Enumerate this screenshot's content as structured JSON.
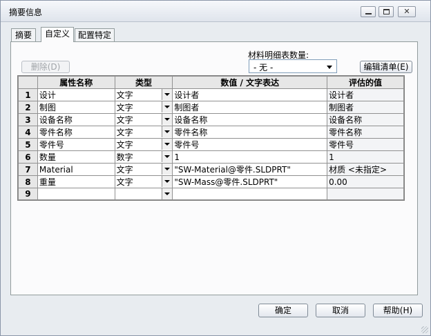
{
  "window": {
    "title": "摘要信息"
  },
  "tabs": [
    {
      "label": "摘要"
    },
    {
      "label": "自定义"
    },
    {
      "label": "配置特定"
    }
  ],
  "toolbar": {
    "delete_label": "删除(D)",
    "bom_qty_label": "材料明细表数量:",
    "bom_qty_value": "- 无 -",
    "edit_list_label": "编辑清单(E)"
  },
  "table": {
    "headers": [
      "属性名称",
      "类型",
      "数值 / 文字表达",
      "评估的值"
    ],
    "rows": [
      {
        "num": "1",
        "name": "设计",
        "type": "文字",
        "value": "设计者",
        "evaluated": "设计者"
      },
      {
        "num": "2",
        "name": "制图",
        "type": "文字",
        "value": "制图者",
        "evaluated": "制图者"
      },
      {
        "num": "3",
        "name": "设备名称",
        "type": "文字",
        "value": "设备名称",
        "evaluated": "设备名称"
      },
      {
        "num": "4",
        "name": "零件名称",
        "type": "文字",
        "value": "零件名称",
        "evaluated": "零件名称"
      },
      {
        "num": "5",
        "name": "零件号",
        "type": "文字",
        "value": "零件号",
        "evaluated": "零件号"
      },
      {
        "num": "6",
        "name": "数量",
        "type": "数字",
        "value": "1",
        "evaluated": "1"
      },
      {
        "num": "7",
        "name": "Material",
        "type": "文字",
        "value": "\"SW-Material@零件.SLDPRT\"",
        "evaluated": "材质 <未指定>"
      },
      {
        "num": "8",
        "name": "重量",
        "type": "文字",
        "value": "\"SW-Mass@零件.SLDPRT\"",
        "evaluated": "0.00"
      },
      {
        "num": "9",
        "name": "",
        "type": "",
        "value": "",
        "evaluated": ""
      }
    ]
  },
  "footer": {
    "ok_label": "确定",
    "cancel_label": "取消",
    "help_label": "帮助(H)"
  }
}
